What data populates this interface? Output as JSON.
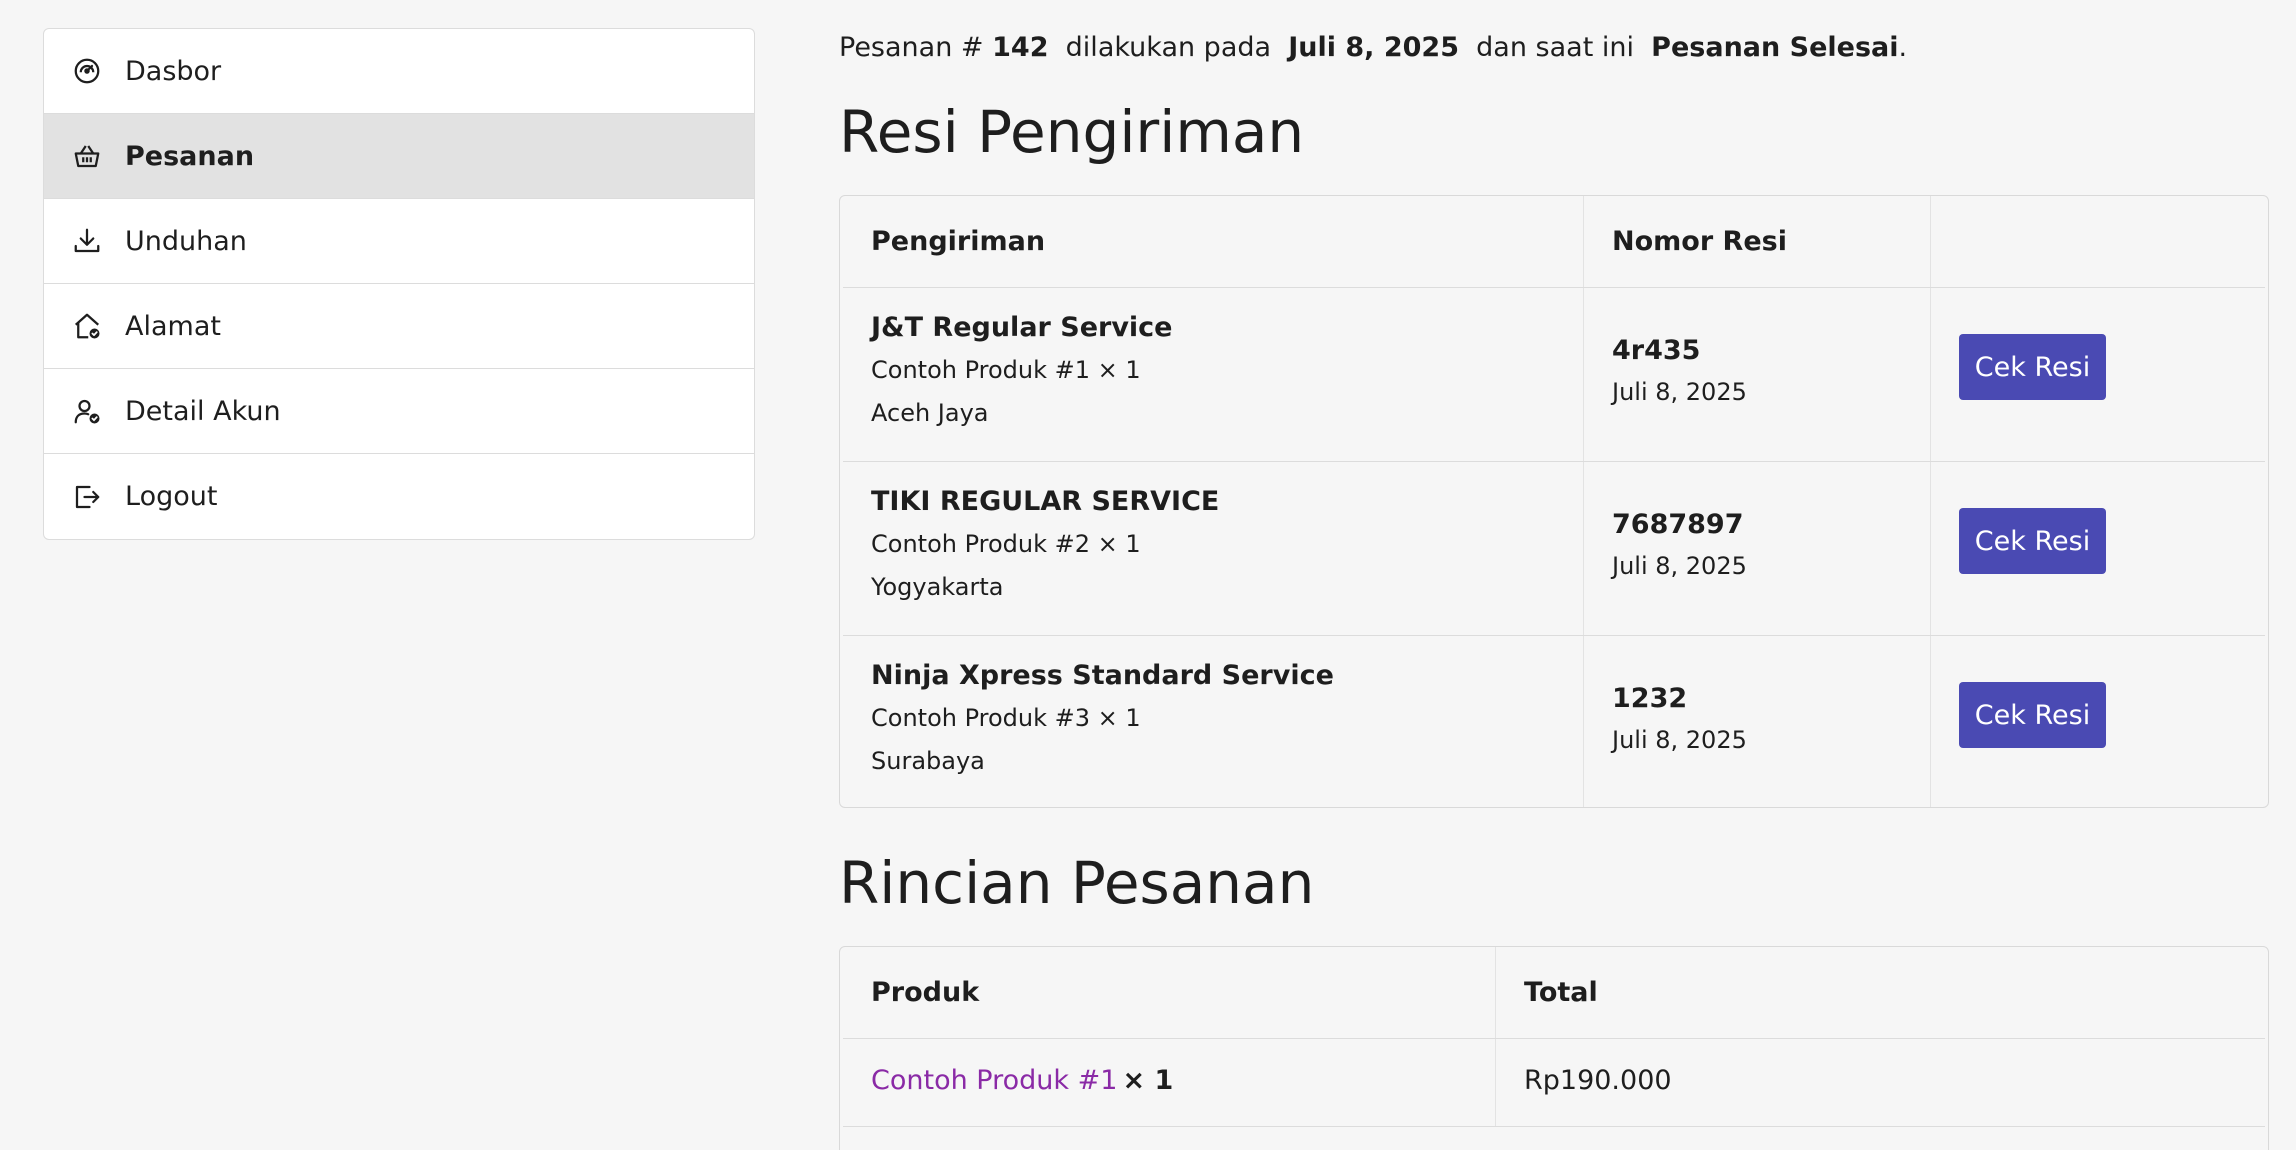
{
  "sidebar": {
    "items": [
      {
        "label": "Dasbor",
        "icon": "dashboard-icon"
      },
      {
        "label": "Pesanan",
        "icon": "basket-icon",
        "active": true
      },
      {
        "label": "Unduhan",
        "icon": "download-icon"
      },
      {
        "label": "Alamat",
        "icon": "home-check-icon"
      },
      {
        "label": "Detail Akun",
        "icon": "user-check-icon"
      },
      {
        "label": "Logout",
        "icon": "logout-icon"
      }
    ]
  },
  "order": {
    "prefix": "Pesanan #",
    "number": "142",
    "placed_on_text": "dilakukan pada",
    "date": "Juli 8, 2025",
    "status_prefix": "dan saat ini",
    "status": "Pesanan Selesai",
    "suffix": "."
  },
  "shipping": {
    "title": "Resi Pengiriman",
    "headers": {
      "shipping": "Pengiriman",
      "tracking": "Nomor Resi"
    },
    "button_label": "Cek Resi",
    "rows": [
      {
        "service": "J&T Regular Service",
        "product": "Contoh Produk #1 × 1",
        "city": "Aceh Jaya",
        "tracking": "4r435",
        "date": "Juli 8, 2025"
      },
      {
        "service": "TIKI REGULAR SERVICE",
        "product": "Contoh Produk #2 × 1",
        "city": "Yogyakarta",
        "tracking": "7687897",
        "date": "Juli 8, 2025"
      },
      {
        "service": "Ninja Xpress Standard Service",
        "product": "Contoh Produk #3 × 1",
        "city": "Surabaya",
        "tracking": "1232",
        "date": "Juli 8, 2025"
      }
    ]
  },
  "details": {
    "title": "Rincian Pesanan",
    "headers": {
      "product": "Produk",
      "total": "Total"
    },
    "rows": [
      {
        "product": "Contoh Produk #1",
        "qty": "× 1",
        "total": "Rp190.000"
      }
    ]
  },
  "colors": {
    "accent_button": "#4a4ab3",
    "link": "#8a2aa6",
    "background": "#f6f6f6"
  }
}
